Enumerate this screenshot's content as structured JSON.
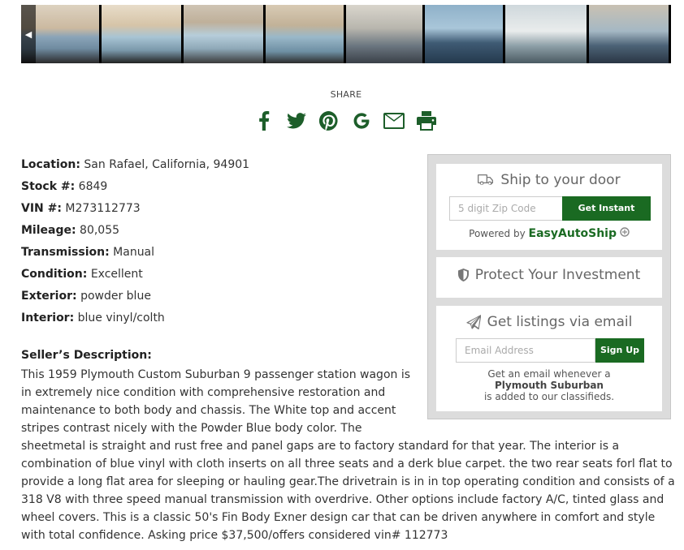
{
  "gallery": {
    "prev_arrow": "◀",
    "thumbnails": [
      "thumb-1",
      "thumb-2",
      "thumb-3",
      "thumb-4",
      "thumb-5",
      "thumb-6",
      "thumb-7",
      "thumb-8"
    ]
  },
  "share": {
    "label": "SHARE",
    "icons": [
      "facebook-icon",
      "twitter-icon",
      "pinterest-icon",
      "google-icon",
      "email-icon",
      "print-icon"
    ]
  },
  "details": [
    {
      "label": "Location:",
      "value": "San Rafael, California, 94901"
    },
    {
      "label": "Stock #:",
      "value": "6849"
    },
    {
      "label": "VIN #:",
      "value": "M273112773"
    },
    {
      "label": "Mileage:",
      "value": "80,055"
    },
    {
      "label": "Transmission:",
      "value": "Manual"
    },
    {
      "label": "Condition:",
      "value": "Excellent"
    },
    {
      "label": "Exterior:",
      "value": "powder blue"
    },
    {
      "label": "Interior:",
      "value": "blue vinyl/colth"
    }
  ],
  "description": {
    "title": "Seller’s Description:",
    "text": "This 1959 Plymouth Custom Suburban 9 passenger station wagon is in extremely nice condition with comprehensive restoration and maintenance to both body and chassis. The White top and accent stripes contrast nicely with the Powder Blue body color. The sheetmetal is straight and rust free and panel gaps are to factory standard for that year. The interior is a combination of blue vinyl with cloth inserts on all three seats and a derk blue carpet. the two rear seats forl flat to provide a long flat area for sleeping or hauling gear.The drivetrain is in in top operating condition and consists of a 318 V8 with three speed manual transmission with overdrive. Other options include factory A/C, tinted glass and wheel covers. This is a classic 50's Fin Body Exner design car that can be driven anywhere in comfort and style with total confidence. Asking price $37,500/offers considered vin# 112773"
  },
  "ship": {
    "title": "Ship to your door",
    "zip_placeholder": "5 digit Zip Code",
    "button": "Get Instant Quote",
    "powered_by": "Powered by",
    "brand": "EasyAutoShip"
  },
  "protect": {
    "title": "Protect Your Investment"
  },
  "listings": {
    "title": "Get listings via email",
    "email_placeholder": "Email Address",
    "button": "Sign Up",
    "note_line1": "Get an email whenever a",
    "note_model": "Plymouth Suburban",
    "note_line3": "is added to our classifieds."
  },
  "colors": {
    "accent_green": "#1a6a22",
    "icon_green": "#1d5e2a"
  }
}
